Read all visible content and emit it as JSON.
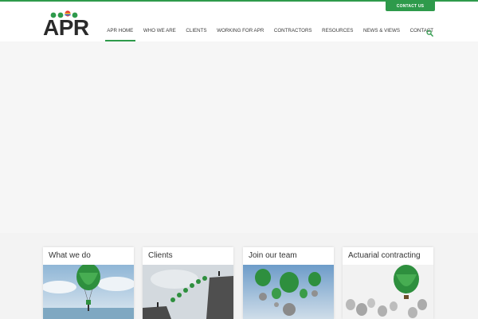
{
  "header": {
    "brand_text": "APR",
    "contact_button": "CONTACT US",
    "accent_color": "#2e9a4b",
    "logo_dot_colors": [
      "#2e9a4b",
      "#2e9a4b",
      "#e63b2e",
      "#2e9a4b"
    ],
    "nav": [
      {
        "label": "APR HOME",
        "active": true
      },
      {
        "label": "WHO WE ARE",
        "active": false
      },
      {
        "label": "CLIENTS",
        "active": false
      },
      {
        "label": "WORKING FOR APR",
        "active": false
      },
      {
        "label": "CONTRACTORS",
        "active": false
      },
      {
        "label": "RESOURCES",
        "active": false
      },
      {
        "label": "NEWS & VIEWS",
        "active": false
      },
      {
        "label": "CONTACT",
        "active": false
      }
    ],
    "search_icon": "search-icon"
  },
  "cards": [
    {
      "title": "What we do",
      "image": "balloon-lifting-person-over-water"
    },
    {
      "title": "Clients",
      "image": "people-bridging-cliffs-with-balloons"
    },
    {
      "title": "Join our team",
      "image": "balloons-lifting-gears"
    },
    {
      "title": "Actuarial contracting",
      "image": "green-balloon-among-grey-balloons"
    }
  ]
}
